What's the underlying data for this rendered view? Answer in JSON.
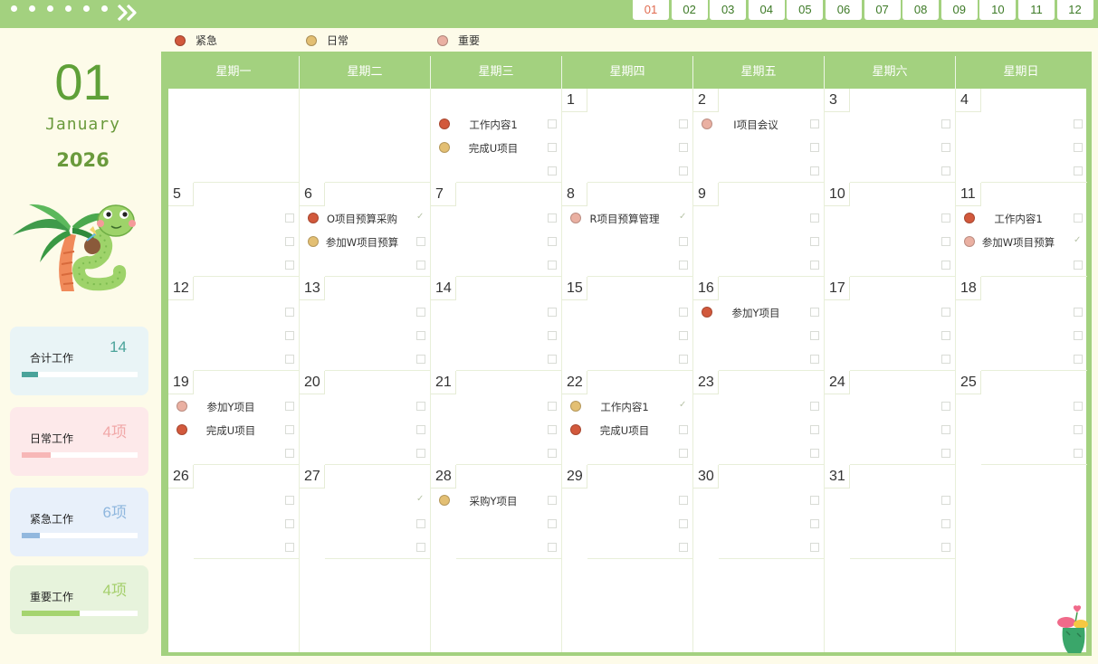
{
  "month_tabs": [
    "01",
    "02",
    "03",
    "04",
    "05",
    "06",
    "07",
    "08",
    "09",
    "10",
    "11",
    "12"
  ],
  "active_month": "01",
  "legend": [
    {
      "label": "紧急",
      "color": "#d2593c"
    },
    {
      "label": "日常",
      "color": "#e3bf73"
    },
    {
      "label": "重要",
      "color": "#eab0a2"
    }
  ],
  "sidebar": {
    "month_number": "01",
    "month_name": "January",
    "year": "2026",
    "stats": [
      {
        "label": "合计工作",
        "value": "14",
        "value_color": "#4aa39a",
        "bg": "#e9f4f6",
        "fill_color": "#4aa39a",
        "progress": 0.14
      },
      {
        "label": "日常工作",
        "value": "4项",
        "value_color": "#f1a8a8",
        "bg": "#fde9ea",
        "fill_color": "#f7b7b7",
        "progress": 0.25
      },
      {
        "label": "紧急工作",
        "value": "6项",
        "value_color": "#8fb7de",
        "bg": "#e8f0fa",
        "fill_color": "#92b8de",
        "progress": 0.16
      },
      {
        "label": "重要工作",
        "value": "4项",
        "value_color": "#a5cf6c",
        "bg": "#e7f3dc",
        "fill_color": "#a5d46f",
        "progress": 0.5
      }
    ]
  },
  "calendar": {
    "weekdays": [
      "星期一",
      "星期二",
      "星期三",
      "星期四",
      "星期五",
      "星期六",
      "星期日"
    ],
    "weeks": [
      [
        {
          "day": "",
          "tasks": []
        },
        {
          "day": "",
          "tasks": []
        },
        {
          "day": "",
          "tasks": [
            {
              "text": "工作内容1",
              "color": "#d2593c",
              "done": false
            },
            {
              "text": "完成U项目",
              "color": "#e3bf73",
              "done": false
            },
            {
              "text": "",
              "color": "",
              "done": false
            }
          ]
        },
        {
          "day": "1",
          "tasks": []
        },
        {
          "day": "2",
          "tasks": [
            {
              "text": "I项目会议",
              "color": "#eab0a2",
              "done": false
            }
          ]
        },
        {
          "day": "3",
          "tasks": []
        },
        {
          "day": "4",
          "tasks": []
        }
      ],
      [
        {
          "day": "5",
          "tasks": []
        },
        {
          "day": "6",
          "tasks": [
            {
              "text": "O项目预算采购",
              "color": "#d2593c",
              "done": true
            },
            {
              "text": "参加W项目预算",
              "color": "#e3bf73",
              "done": false
            }
          ]
        },
        {
          "day": "7",
          "tasks": []
        },
        {
          "day": "8",
          "tasks": [
            {
              "text": "R项目预算管理",
              "color": "#eab0a2",
              "done": true
            }
          ]
        },
        {
          "day": "9",
          "tasks": []
        },
        {
          "day": "10",
          "tasks": []
        },
        {
          "day": "11",
          "tasks": [
            {
              "text": "工作内容1",
              "color": "#d2593c",
              "done": false
            },
            {
              "text": "参加W项目预算",
              "color": "#eab0a2",
              "done": true
            }
          ]
        }
      ],
      [
        {
          "day": "12",
          "tasks": []
        },
        {
          "day": "13",
          "tasks": []
        },
        {
          "day": "14",
          "tasks": []
        },
        {
          "day": "15",
          "tasks": []
        },
        {
          "day": "16",
          "tasks": [
            {
              "text": "参加Y项目",
              "color": "#d2593c",
              "done": false
            }
          ]
        },
        {
          "day": "17",
          "tasks": []
        },
        {
          "day": "18",
          "tasks": []
        }
      ],
      [
        {
          "day": "19",
          "tasks": [
            {
              "text": "参加Y项目",
              "color": "#eab0a2",
              "done": false
            },
            {
              "text": "完成U项目",
              "color": "#d2593c",
              "done": false
            }
          ]
        },
        {
          "day": "20",
          "tasks": []
        },
        {
          "day": "21",
          "tasks": []
        },
        {
          "day": "22",
          "tasks": [
            {
              "text": "工作内容1",
              "color": "#e3bf73",
              "done": true
            },
            {
              "text": "完成U项目",
              "color": "#d2593c",
              "done": false
            }
          ]
        },
        {
          "day": "23",
          "tasks": []
        },
        {
          "day": "24",
          "tasks": []
        },
        {
          "day": "25",
          "tasks": []
        }
      ],
      [
        {
          "day": "26",
          "tasks": []
        },
        {
          "day": "27",
          "tasks": [
            {
              "text": "",
              "color": "",
              "done": true
            }
          ]
        },
        {
          "day": "28",
          "tasks": [
            {
              "text": "采购Y项目",
              "color": "#e3bf73",
              "done": false
            }
          ]
        },
        {
          "day": "29",
          "tasks": []
        },
        {
          "day": "30",
          "tasks": []
        },
        {
          "day": "31",
          "tasks": []
        },
        {
          "day": "",
          "tasks": []
        }
      ],
      [
        {
          "day": "",
          "tasks": []
        },
        {
          "day": "",
          "tasks": []
        },
        {
          "day": "",
          "tasks": []
        },
        {
          "day": "",
          "tasks": []
        },
        {
          "day": "",
          "tasks": []
        },
        {
          "day": "",
          "tasks": []
        },
        {
          "day": "",
          "tasks": []
        }
      ]
    ]
  }
}
